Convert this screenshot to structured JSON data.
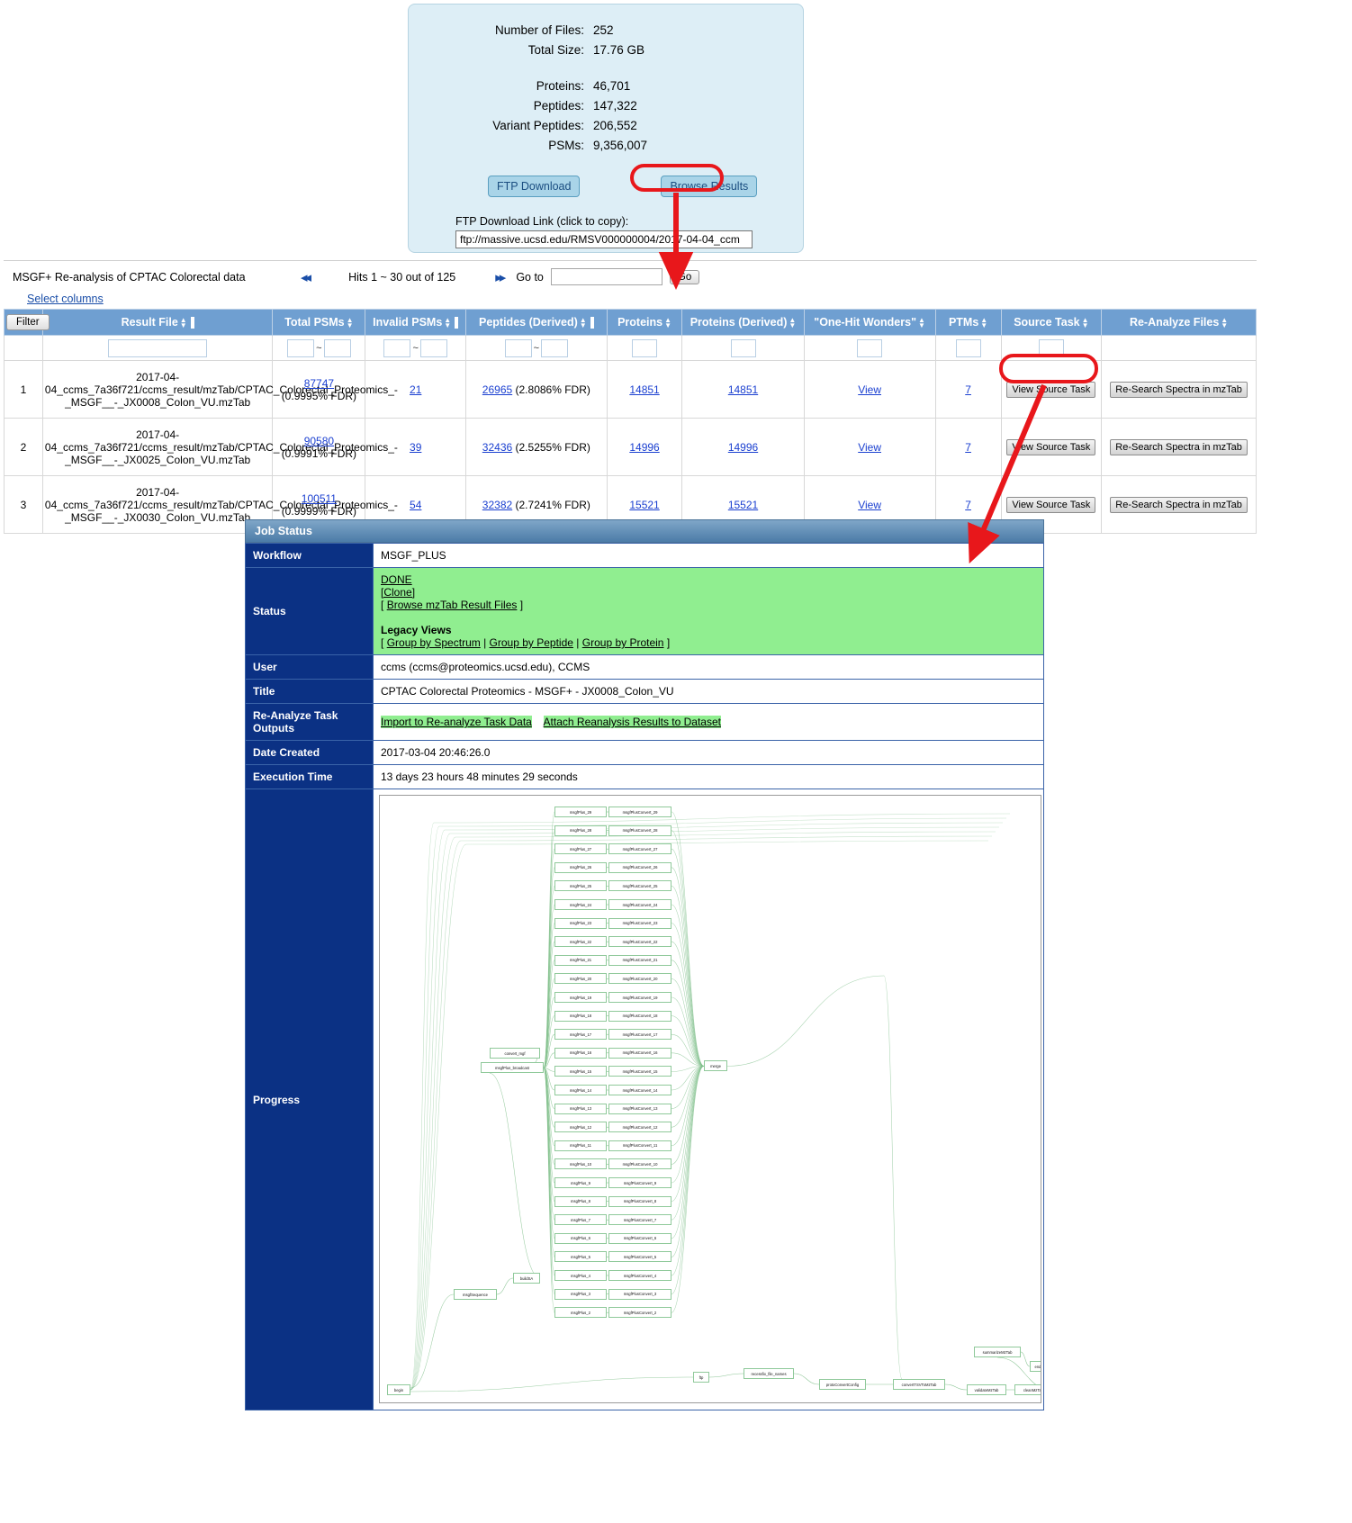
{
  "summary": {
    "stats": [
      {
        "label": "Number of Files:",
        "value": "252"
      },
      {
        "label": "Total Size:",
        "value": "17.76 GB"
      }
    ],
    "counts": [
      {
        "label": "Proteins:",
        "value": "46,701"
      },
      {
        "label": "Peptides:",
        "value": "147,322"
      },
      {
        "label": "Variant Peptides:",
        "value": "206,552"
      },
      {
        "label": "PSMs:",
        "value": "9,356,007"
      }
    ],
    "ftp_download_label": "FTP Download",
    "browse_results_label": "Browse Results",
    "ftp_link_label": "FTP Download Link (click to copy):",
    "ftp_link_value": "ftp://massive.ucsd.edu/RMSV000000004/2017-04-04_ccm",
    "panel_bg": "#ddeef6",
    "highlight_color": "#e8171b"
  },
  "results": {
    "title": "MSGF+ Re-analysis of CPTAC Colorectal data",
    "select_columns": "Select columns",
    "prev_icon": "double-left-arrow-icon",
    "next_icon": "double-right-arrow-icon",
    "hits_text": "Hits 1 ~ 30 out of 125",
    "goto_label": "Go to",
    "goto_value": "",
    "go_label": "Go",
    "filter_label": "Filter",
    "tilde": "~",
    "columns": [
      "Result File",
      "Total PSMs",
      "Invalid PSMs",
      "Peptides (Derived)",
      "Proteins",
      "Proteins (Derived)",
      "\"One-Hit Wonders\"",
      "PTMs",
      "Source Task",
      "Re-Analyze Files"
    ],
    "view_source_task_label": "View Source Task",
    "re_search_label": "Re-Search Spectra in mzTab",
    "view_label": "View",
    "rows": [
      {
        "index": "1",
        "result_file": "2017-04-04_ccms_7a36f721/ccms_result/mzTab/CPTAC_Colorectal_Proteomics_-_MSGF__-_JX0008_Colon_VU.mzTab",
        "total_psms": "87747",
        "total_psms_fdr": "(0.9995% FDR)",
        "invalid_psms": "21",
        "peptides": "26965",
        "peptides_fdr": "(2.8086% FDR)",
        "proteins": "14851",
        "proteins_derived": "14851",
        "one_hit_wonders": "View",
        "ptms": "7"
      },
      {
        "index": "2",
        "result_file": "2017-04-04_ccms_7a36f721/ccms_result/mzTab/CPTAC_Colorectal_Proteomics_-_MSGF__-_JX0025_Colon_VU.mzTab",
        "total_psms": "90580",
        "total_psms_fdr": "(0.9991% FDR)",
        "invalid_psms": "39",
        "peptides": "32436",
        "peptides_fdr": "(2.5255% FDR)",
        "proteins": "14996",
        "proteins_derived": "14996",
        "one_hit_wonders": "View",
        "ptms": "7"
      },
      {
        "index": "3",
        "result_file": "2017-04-04_ccms_7a36f721/ccms_result/mzTab/CPTAC_Colorectal_Proteomics_-_MSGF__-_JX0030_Colon_VU.mzTab",
        "total_psms": "100511",
        "total_psms_fdr": "(0.9999% FDR)",
        "invalid_psms": "54",
        "peptides": "32382",
        "peptides_fdr": "(2.7241% FDR)",
        "proteins": "15521",
        "proteins_derived": "15521",
        "one_hit_wonders": "View",
        "ptms": "7"
      }
    ]
  },
  "job_status": {
    "panel_title": "Job Status",
    "workflow_label": "Workflow",
    "workflow_value": "MSGF_PLUS",
    "status_label": "Status",
    "status_value": "DONE",
    "status_clone": "[Clone]",
    "status_browse_open": "[",
    "status_browse": "Browse mzTab Result Files",
    "status_browse_close": "]",
    "legacy_title": "Legacy Views",
    "legacy_open": "[",
    "legacy_spectrum": "Group by Spectrum",
    "legacy_peptide": "Group by Peptide",
    "legacy_protein": "Group by Protein",
    "legacy_close": "]",
    "legacy_sep": "|",
    "user_label": "User",
    "user_value": "ccms (ccms@proteomics.ucsd.edu), CCMS",
    "title_label": "Title",
    "title_value": "CPTAC Colorectal Proteomics - MSGF+ - JX0008_Colon_VU",
    "reanalyze_label": "Re-Analyze Task Outputs",
    "reanalyze_import": "Import to Re-analyze Task Data",
    "reanalyze_attach": "Attach Reanalysis Results to Dataset",
    "date_created_label": "Date Created",
    "date_created_value": "2017-03-04 20:46:26.0",
    "exec_time_label": "Execution Time",
    "exec_time_value": "13 days 23 hours 48 minutes 29 seconds",
    "progress_label": "Progress",
    "status_bg": "#90ee90",
    "label_bg": "#0b3184"
  },
  "workflow_graph": {
    "node_color": "#8fc99a",
    "edge_color": "#7fbf8a",
    "left_nodes": [
      "convert_mgf",
      "msgfPlus_broadcast"
    ],
    "right_node": "merge",
    "aux_nodes": [
      "buildSA",
      "msgfSequence"
    ],
    "bottom_nodes": [
      "begin",
      "ftp",
      "recessfix_file_names",
      "protoConvertConfig",
      "convertTSVToMzTab",
      "validateMzTab",
      "cleanMzTab",
      "summarizeMzTab",
      "end"
    ],
    "pair_prefix_left": "msgfPlus_",
    "pair_prefix_right": "msgfPlusConvert_",
    "pair_indices": [
      29,
      28,
      27,
      26,
      25,
      24,
      23,
      22,
      21,
      20,
      19,
      18,
      17,
      16,
      15,
      14,
      13,
      12,
      11,
      10,
      9,
      8,
      7,
      6,
      5,
      4,
      3,
      2
    ]
  }
}
